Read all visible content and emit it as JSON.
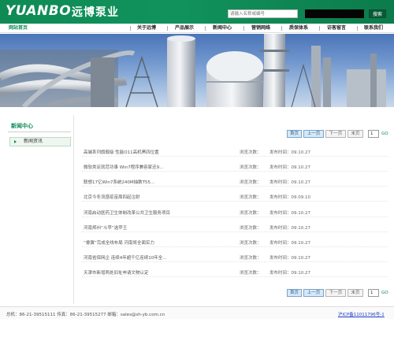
{
  "header": {
    "logo_en": "YUANBO",
    "logo_cn": "远博泵业",
    "search_placeholder": "请输入名称或编号",
    "search_button": "搜索"
  },
  "nav": {
    "home": "网站首页",
    "items": [
      "关于远博",
      "产品展示",
      "新闻中心",
      "营销网络",
      "质保体系",
      "访客留言",
      "联系我们"
    ]
  },
  "sidebar": {
    "title": "新闻中心",
    "items": [
      "新闻资讯"
    ]
  },
  "pager": {
    "first": "首页",
    "prev": "上一页",
    "next": "下一页",
    "last": "末页",
    "page": "1",
    "go": "GO"
  },
  "news": {
    "views_label": "浏览次数：",
    "date_label": "发布时间：",
    "items": [
      {
        "title": "高端系列旗舰级 性能O11高机黑四位置",
        "date": "09.10.27"
      },
      {
        "title": "微软类足就范功事 Win7程序兼容家还9...",
        "date": "09.10.27"
      },
      {
        "title": "联想17亿Win7系统240M抽数T55...",
        "date": "09.10.27"
      },
      {
        "title": "北京今冬流感疫苗周四起注射",
        "date": "09.09.10"
      },
      {
        "title": "河南启动医药卫生体制改革公共卫生服务项目",
        "date": "09.10.27"
      },
      {
        "title": "河南郑州“斗苹”选苹王",
        "date": "09.10.27"
      },
      {
        "title": "“睿翼”完成全线布局 河南将全面实力",
        "date": "09.10.27"
      },
      {
        "title": "河南省保网企 连续4年超千亿连续10年全...",
        "date": "09.10.27"
      },
      {
        "title": "天津市新增两处旧址申请文物认定",
        "date": "09.10.27"
      }
    ]
  },
  "footer": {
    "text": "总机：86-21-39515111 传真：86-21-39515277 邮箱：sales@sh-yb.com.cn",
    "icp": "沪ICP备11011796号-1"
  },
  "colors": {
    "brand_green": "#0f8a55",
    "link_blue": "#1a3cc8"
  }
}
